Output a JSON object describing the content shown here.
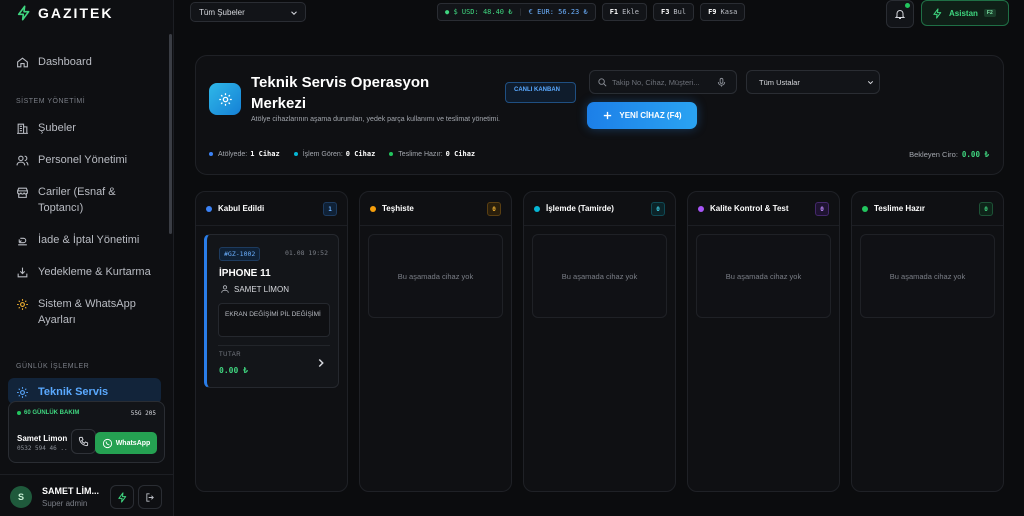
{
  "brand": {
    "name": "GAZITEK"
  },
  "sidebar": {
    "dashboard": "Dashboard",
    "section_system": "SİSTEM YÖNETİMİ",
    "items": [
      {
        "label": "Şubeler"
      },
      {
        "label": "Personel Yönetimi"
      },
      {
        "label": "Cariler (Esnaf & Toptancı)"
      },
      {
        "label": "İade & İptal Yönetimi"
      },
      {
        "label": "Yedekleme & Kurtarma"
      },
      {
        "label": "Sistem & WhatsApp Ayarları"
      }
    ],
    "section_daily": "GÜNLÜK İŞLEMLER",
    "active_item": "Teknik Servis"
  },
  "whatsapp_card": {
    "title": "60 GÜNLÜK BAKIM",
    "plate": "55G 205",
    "name": "Samet Limon",
    "phone": "0532 594 46 ..",
    "button": "WhatsApp"
  },
  "user": {
    "name": "SAMET LİM...",
    "role": "Super admin"
  },
  "topbar": {
    "branch": "Tüm Şubeler",
    "usd": "$ USD: 48.40 ₺",
    "eur": "€ EUR: 56.23 ₺",
    "shortcuts": [
      {
        "key": "F1",
        "label": "Ekle"
      },
      {
        "key": "F3",
        "label": "Bul"
      },
      {
        "key": "F9",
        "label": "Kasa"
      }
    ],
    "assistant": "Asistan",
    "assistant_key": "F2",
    "colors": {
      "accent_green": "#22c55e",
      "accent_blue": "#2a8cf0"
    }
  },
  "header": {
    "title": "Teknik Servis Operasyon Merkezi",
    "live_badge": "CANLI KANBAN",
    "subtitle": "Atölye cihazlarının aşama durumları, yedek parça kullanımı ve teslimat yönetimi.",
    "search_placeholder": "Takip No, Cihaz, Müşteri...",
    "masters": "Tüm Ustalar",
    "new_button": "YENİ CİHAZ (F4)",
    "stats": [
      {
        "label": "Atölyede:",
        "value": "1 Cihaz",
        "color": "#3b82f6"
      },
      {
        "label": "İşlem Gören:",
        "value": "0 Cihaz",
        "color": "#06b6d4"
      },
      {
        "label": "Teslime Hazır:",
        "value": "0 Cihaz",
        "color": "#22c55e"
      }
    ],
    "ciro_label": "Bekleyen Ciro:",
    "ciro_value": "0.00 ₺"
  },
  "columns": [
    {
      "title": "Kabul Edildi",
      "count": "1",
      "color": "#3b82f6"
    },
    {
      "title": "Teşhiste",
      "count": "0",
      "color": "#f59e0b",
      "empty": "Bu aşamada cihaz yok"
    },
    {
      "title": "İşlemde (Tamirde)",
      "count": "0",
      "color": "#06b6d4",
      "empty": "Bu aşamada cihaz yok"
    },
    {
      "title": "Kalite Kontrol & Test",
      "count": "0",
      "color": "#a855f7",
      "empty": "Bu aşamada cihaz yok"
    },
    {
      "title": "Teslime Hazır",
      "count": "0",
      "color": "#22c55e",
      "empty": "Bu aşamada cihaz yok"
    }
  ],
  "card": {
    "id": "#GZ-1002",
    "date": "01.08 19:52",
    "device": "İPHONE 11",
    "customer": "SAMET LİMON",
    "issue": "EKRAN DEĞİŞİMİ PİL DEĞİŞİMİ",
    "total_label": "TUTAR",
    "total": "0.00 ₺"
  }
}
